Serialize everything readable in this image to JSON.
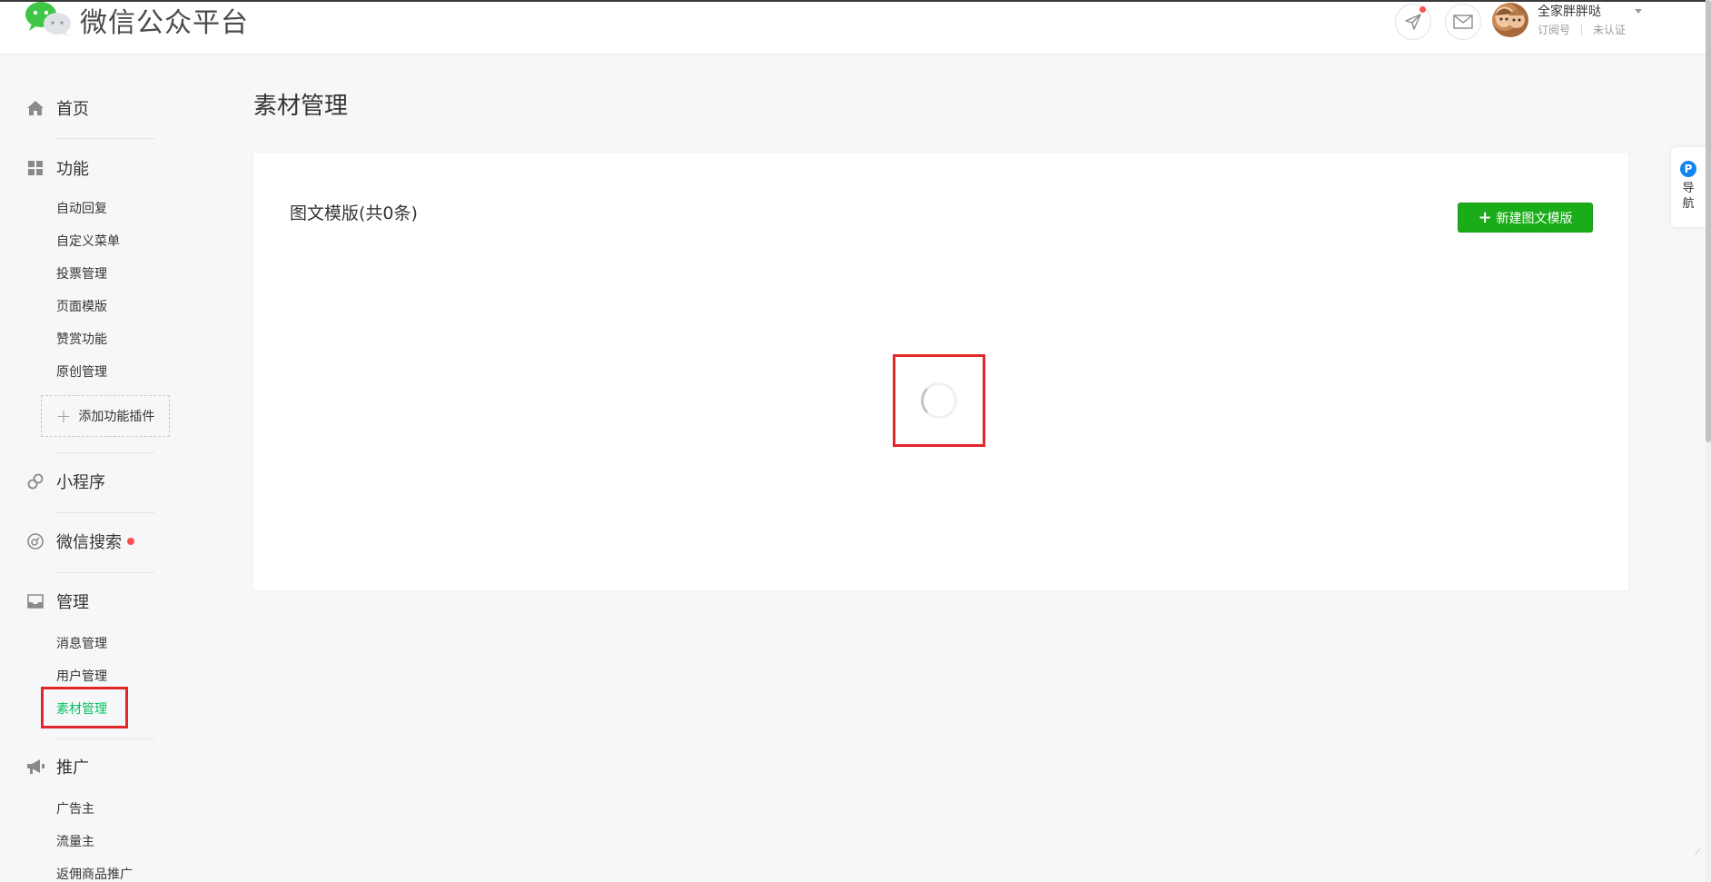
{
  "header": {
    "brand_name": "微信公众平台",
    "account_name": "全家胖胖哒",
    "account_type": "订阅号",
    "verification": "未认证",
    "icons": {
      "logo": "wechat-logo-icon",
      "send": "paper-plane-icon",
      "mail": "envelope-icon",
      "avatar": "avatar-image",
      "caret": "caret-down-icon"
    },
    "notification_dot_color": "#fa5151"
  },
  "sidebar": {
    "home": {
      "label": "首页",
      "icon": "home-icon"
    },
    "features": {
      "label": "功能",
      "icon": "grid-icon",
      "items": [
        "自动回复",
        "自定义菜单",
        "投票管理",
        "页面模版",
        "赞赏功能",
        "原创管理"
      ],
      "add_plugin_label": "添加功能插件"
    },
    "miniprogram": {
      "label": "小程序",
      "icon": "link-icon"
    },
    "search": {
      "label": "微信搜索",
      "icon": "search-icon",
      "has_red_dot": true
    },
    "manage": {
      "label": "管理",
      "icon": "inbox-icon",
      "items": [
        "消息管理",
        "用户管理",
        "素材管理"
      ],
      "active_item": "素材管理"
    },
    "promote": {
      "label": "推广",
      "icon": "megaphone-icon",
      "items": [
        "广告主",
        "流量主",
        "返佣商品推广"
      ]
    }
  },
  "main": {
    "page_title": "素材管理",
    "card": {
      "title": "图文模版(共0条)",
      "new_button_label": "新建图文模版"
    },
    "loading": true
  },
  "float_nav": {
    "badge": "P",
    "label_1": "导",
    "label_2": "航"
  },
  "colors": {
    "accent_green": "#07c160",
    "button_green": "#1aad19",
    "highlight_red": "#e2262a",
    "badge_blue": "#1485ee"
  }
}
